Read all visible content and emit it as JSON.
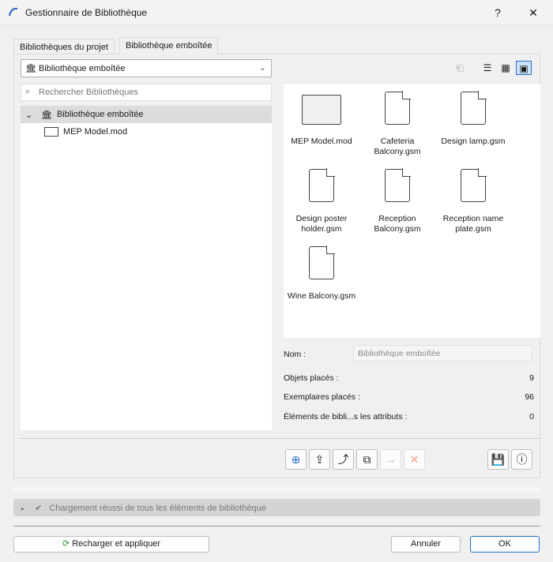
{
  "window": {
    "title": "Gestionnaire de Bibliothèque",
    "help": "?",
    "close": "✕"
  },
  "tabs": [
    {
      "label": "Bibliothèques du projet"
    },
    {
      "label": "Bibliothèque emboîtée",
      "active": true
    }
  ],
  "dropdown": {
    "value": "Bibliothèque emboîtée"
  },
  "search": {
    "placeholder": "Rechercher Bibliothèques"
  },
  "tree": {
    "root": "Bibliothèque emboîtée",
    "children": [
      "MEP Model.mod"
    ]
  },
  "items": [
    {
      "label": "MEP Model.mod",
      "icon": "folder"
    },
    {
      "label": "Cafeteria Balcony.gsm",
      "icon": "object"
    },
    {
      "label": "Design lamp.gsm",
      "icon": "object"
    },
    {
      "label": "Design poster holder.gsm",
      "icon": "object"
    },
    {
      "label": "Reception Balcony.gsm",
      "icon": "object"
    },
    {
      "label": "Reception name plate.gsm",
      "icon": "object"
    },
    {
      "label": "Wine Balcony.gsm",
      "icon": "object"
    }
  ],
  "info": {
    "name_label": "Nom :",
    "name_value": "Bibliothèque emboîtée",
    "rows": [
      {
        "label": "Objets placés :",
        "value": "9"
      },
      {
        "label": "Exemplaires placés :",
        "value": "96"
      },
      {
        "label": "Éléments de bibli...s les attributs :",
        "value": "0"
      }
    ]
  },
  "status": {
    "text": "Chargement réussi de tous les éléments de bibliothèque"
  },
  "buttons": {
    "reload": "Recharger et appliquer",
    "cancel": "Annuler",
    "ok": "OK"
  }
}
